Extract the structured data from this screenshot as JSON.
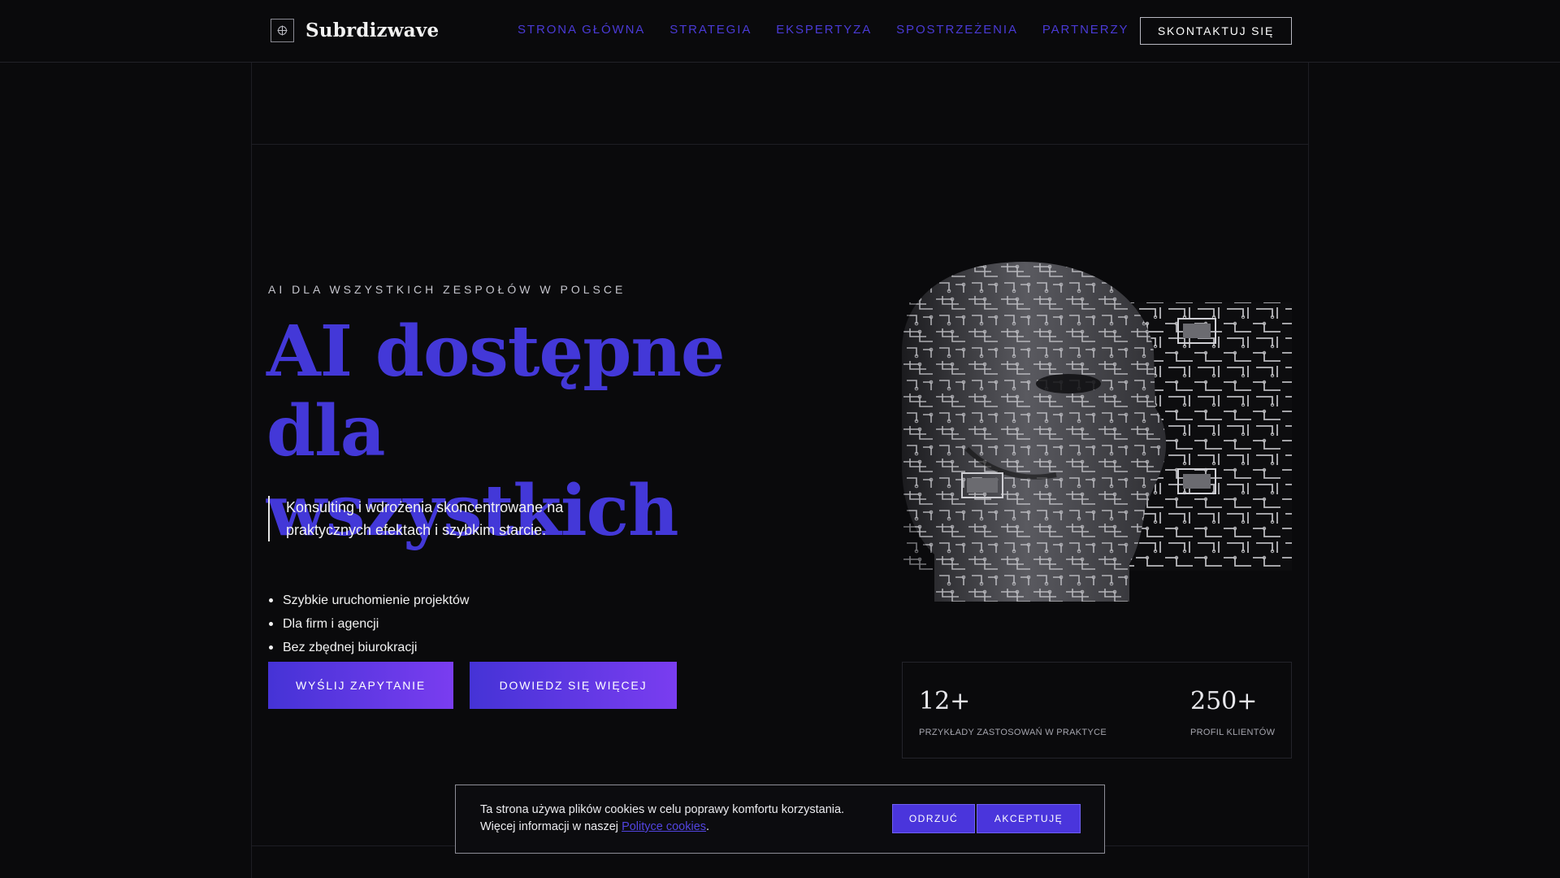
{
  "header": {
    "brand": "Subrdizwave",
    "nav": [
      {
        "label": "STRONA GŁÓWNA"
      },
      {
        "label": "STRATEGIA"
      },
      {
        "label": "EKSPERTYZA"
      },
      {
        "label": "SPOSTRZEŻENIA"
      },
      {
        "label": "PARTNERZY"
      }
    ],
    "contact_label": "SKONTAKTUJ SIĘ"
  },
  "hero": {
    "eyebrow": "AI DLA WSZYSTKICH ZESPOŁÓW W POLSCE",
    "title_line1": "AI dostępne dla",
    "title_line2": "wszystkich",
    "lead_line1": "Konsulting i wdrożenia skoncentrowane na",
    "lead_line2": "praktycznych efektach i szybkim starcie.",
    "bullets": [
      "Szybkie uruchomienie projektów",
      "Dla firm i agencji",
      "Bez zbędnej biurokracji"
    ],
    "primary_cta": "WYŚLIJ ZAPYTANIE",
    "secondary_cta": "DOWIEDZ SIĘ WIĘCEJ"
  },
  "stats": [
    {
      "value": "12+",
      "label": "PRZYKŁADY ZASTOSOWAŃ W PRAKTYCE"
    },
    {
      "value": "250+",
      "label": "PROFIL KLIENTÓW"
    }
  ],
  "cookie": {
    "line1": "Ta strona używa plików cookies w celu poprawy komfortu korzystania.",
    "line2_prefix": "Więcej informacji w naszej",
    "link_text": "Polityce cookies",
    "line2_suffix": ".",
    "reject_label": "ODRZUĆ",
    "accept_label": "AKCEPTUJĘ"
  },
  "colors": {
    "accent": "#4338d8",
    "background": "#0a0a0c",
    "gradient_end": "#7a3df0"
  },
  "icons": {
    "logo": "crosshair-icon"
  }
}
